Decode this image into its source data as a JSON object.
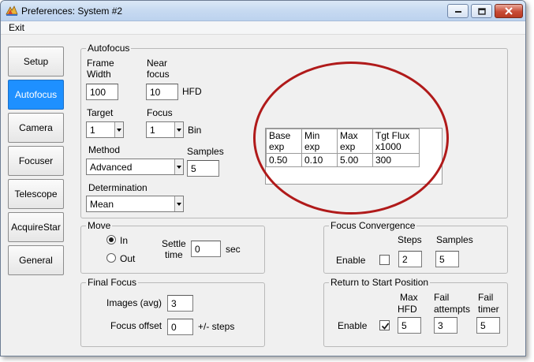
{
  "window": {
    "title": "Preferences: System #2",
    "controls": [
      "minimize",
      "maximize",
      "close"
    ]
  },
  "menu": {
    "exit": "Exit"
  },
  "sidebar": {
    "items": [
      {
        "label": "Setup"
      },
      {
        "label": "Autofocus",
        "active": true
      },
      {
        "label": "Camera"
      },
      {
        "label": "Focuser"
      },
      {
        "label": "Telescope"
      },
      {
        "label": "AcquireStar"
      },
      {
        "label": "General"
      }
    ]
  },
  "autofocus": {
    "title": "Autofocus",
    "frame_width_label_1": "Frame",
    "frame_width_label_2": "Width",
    "frame_width_value": "100",
    "near_focus_label_1": "Near",
    "near_focus_label_2": "focus",
    "near_focus_value": "10",
    "hfd_label": "HFD",
    "target_label": "Target",
    "target_value": "1",
    "focus_label": "Focus",
    "focus_value": "1",
    "bin_label": "Bin",
    "method_label": "Method",
    "method_value": "Advanced",
    "samples_label": "Samples",
    "samples_value": "5",
    "determination_label": "Determination",
    "determination_value": "Mean",
    "exposure_table": {
      "headers": [
        [
          "Base",
          "exp"
        ],
        [
          "Min",
          "exp"
        ],
        [
          "Max",
          "exp"
        ],
        [
          "Tgt Flux",
          "x1000"
        ]
      ],
      "values": [
        "0.50",
        "0.10",
        "5.00",
        "300"
      ]
    }
  },
  "move": {
    "title": "Move",
    "in_label": "In",
    "out_label": "Out",
    "selected": "In",
    "settle_label_1": "Settle",
    "settle_label_2": "time",
    "settle_value": "0",
    "sec_label": "sec"
  },
  "focus_convergence": {
    "title": "Focus Convergence",
    "steps_label": "Steps",
    "samples_label": "Samples",
    "enable_label": "Enable",
    "enabled": false,
    "steps_value": "2",
    "samples_value": "5"
  },
  "final_focus": {
    "title": "Final Focus",
    "images_label": "Images (avg)",
    "images_value": "3",
    "offset_label": "Focus offset",
    "offset_value": "0",
    "steps_suffix": "+/- steps"
  },
  "return_start": {
    "title": "Return to Start Position",
    "max_hfd_label_1": "Max",
    "max_hfd_label_2": "HFD",
    "fail_attempts_label_1": "Fail",
    "fail_attempts_label_2": "attempts",
    "fail_timer_label_1": "Fail",
    "fail_timer_label_2": "timer",
    "enable_label": "Enable",
    "enabled": true,
    "max_hfd_value": "5",
    "fail_attempts_value": "3",
    "fail_timer_value": "5"
  },
  "colors": {
    "active_tab": "#1e90ff",
    "annotation_ellipse": "#b01a1a"
  }
}
